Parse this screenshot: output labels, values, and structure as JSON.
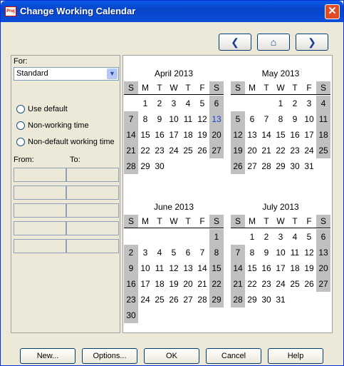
{
  "window": {
    "title": "Change Working Calendar",
    "close_glyph": "✕",
    "app_icon_text": "Proj"
  },
  "nav": {
    "prev_glyph": "❮",
    "home_glyph": "⌂",
    "next_glyph": "❯"
  },
  "left": {
    "for_label": "For:",
    "calendar_value": "Standard",
    "radios": [
      "Use default",
      "Non-working time",
      "Non-default working time"
    ],
    "from_label": "From:",
    "to_label": "To:"
  },
  "dow": [
    "S",
    "M",
    "T",
    "W",
    "T",
    "F",
    "S"
  ],
  "months": [
    {
      "title": "April 2013",
      "start": 1,
      "days": 30,
      "today": 13,
      "shadeAll": []
    },
    {
      "title": "May 2013",
      "start": 3,
      "days": 31,
      "today": null,
      "shadeAll": []
    },
    {
      "title": "June 2013",
      "start": 6,
      "days": 30,
      "today": null,
      "shadeAll": []
    },
    {
      "title": "July 2013",
      "start": 1,
      "days": 31,
      "today": null,
      "shadeAll": []
    }
  ],
  "buttons": {
    "new": "New...",
    "options": "Options...",
    "ok": "OK",
    "cancel": "Cancel",
    "help": "Help"
  }
}
